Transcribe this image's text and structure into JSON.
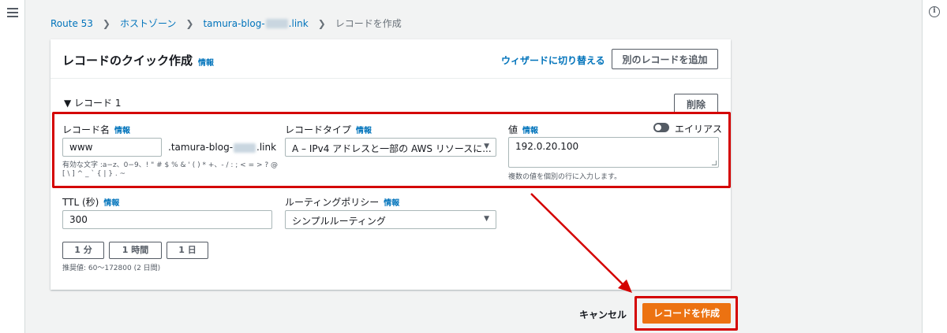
{
  "breadcrumb": {
    "route53": "Route 53",
    "hosted_zones": "ホストゾーン",
    "zone_prefix": "tamura-blog-",
    "zone_suffix": ".link",
    "current": "レコードを作成"
  },
  "panel": {
    "title": "レコードのクイック作成",
    "info": "情報",
    "wizard_link": "ウィザードに切り替える",
    "add_record": "別のレコードを追加"
  },
  "record": {
    "toggle_label": "▼ レコード 1",
    "delete": "削除",
    "name_label": "レコード名",
    "name_info": "情報",
    "name_value": "www",
    "name_suffix_prefix": ".tamura-blog-",
    "name_suffix_end": ".link",
    "name_hint_1": "有効な文字 :a−z、0−9、! \" # $ % & ' ( ) * +、- / : ; < = > ? @",
    "name_hint_2": "[ \\ ] ^ _ ` { | } . ~",
    "type_label": "レコードタイプ",
    "type_info": "情報",
    "type_value": "A – IPv4 アドレスと一部の AWS リソースに...",
    "value_label": "値",
    "value_info": "情報",
    "alias_label": "エイリアス",
    "value_text": "192.0.20.100",
    "value_hint": "複数の値を個別の行に入力します。",
    "ttl_label": "TTL (秒)",
    "ttl_info": "情報",
    "ttl_value": "300",
    "routing_label": "ルーティングポリシー",
    "routing_info": "情報",
    "routing_value": "シンプルルーティング",
    "durations": [
      "1 分",
      "1 時間",
      "1 日"
    ],
    "ttl_hint": "推奨値: 60〜172800 (2 日間)"
  },
  "footer": {
    "cancel": "キャンセル",
    "create": "レコードを作成"
  },
  "colors": {
    "accent": "#ec7211",
    "link": "#0073bb",
    "highlight": "#d40000"
  }
}
